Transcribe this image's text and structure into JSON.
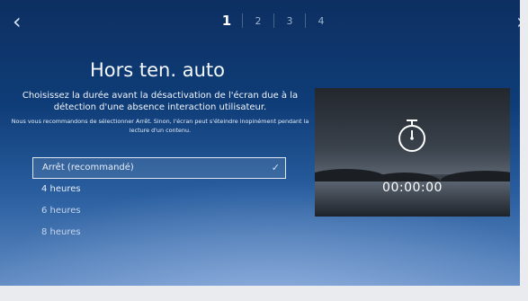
{
  "nav": {
    "back_icon": "chevron-left-icon",
    "forward_icon": "chevron-right-icon"
  },
  "steps": {
    "items": [
      "1",
      "2",
      "3",
      "4"
    ],
    "active_index": 0
  },
  "screen": {
    "title": "Hors ten. auto",
    "description": "Choisissez la durée avant la désactivation de l'écran due à la détection d'une absence interaction utilisateur.",
    "note": "Nous vous recommandons de sélectionner Arrêt. Sinon, l'écran peut s'éteindre inopinément pendant la lecture d'un contenu."
  },
  "options": [
    {
      "label": "Arrêt (recommandé)",
      "selected": true
    },
    {
      "label": "4 heures",
      "selected": false
    },
    {
      "label": "6 heures",
      "selected": false
    },
    {
      "label": "8 heures",
      "selected": false
    }
  ],
  "preview": {
    "icon": "stopwatch-icon",
    "time": "00:00:00"
  }
}
